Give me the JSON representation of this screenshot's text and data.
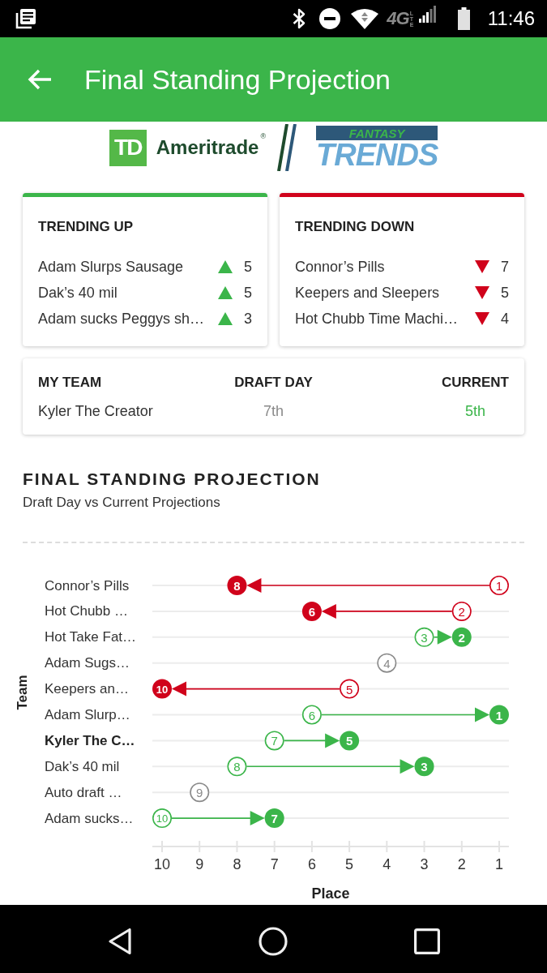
{
  "status_bar": {
    "network": "4G",
    "network_detail": "LTE",
    "time": "11:46"
  },
  "app_bar": {
    "title": "Final Standing Projection"
  },
  "sponsor_logos": {
    "td_mark": "TD",
    "brand": "Ameritrade",
    "registered": "®",
    "product_top": "FANTASY",
    "product": "TRENDS"
  },
  "trend_cards": [
    {
      "kind": "up",
      "title": "TRENDING UP",
      "items": [
        {
          "team": "Adam Slurps Sausage",
          "change": "5"
        },
        {
          "team": "Dak’s 40 mil",
          "change": "5"
        },
        {
          "team": "Adam sucks Peggys sh…",
          "change": "3"
        }
      ]
    },
    {
      "kind": "down",
      "title": "TRENDING DOWN",
      "items": [
        {
          "team": "Connor’s Pills",
          "change": "7"
        },
        {
          "team": "Keepers and Sleepers",
          "change": "5"
        },
        {
          "team": "Hot Chubb Time Machi…",
          "change": "4"
        }
      ]
    }
  ],
  "my_team": {
    "columns": [
      "MY TEAM",
      "DRAFT DAY",
      "CURRENT"
    ],
    "team": "Kyler The Creator",
    "draft_day": "7th",
    "current": "5th"
  },
  "chart": {
    "title": "FINAL STANDING PROJECTION",
    "subtitle": "Draft Day vs Current Projections",
    "bold_rows": [
      false,
      false,
      false,
      false,
      false,
      false,
      true,
      false,
      false,
      false
    ],
    "chart_data": {
      "type": "scatter",
      "orientation": "horizontal",
      "xlabel": "Place",
      "ylabel": "Team",
      "categories": [
        "Connor’s Pills",
        "Hot Chubb …",
        "Hot Take Fat…",
        "Adam Sugs…",
        "Keepers an…",
        "Adam Slurp…",
        "Kyler The C…",
        "Dak’s 40 mil",
        "Auto draft …",
        "Adam sucks…"
      ],
      "series": [
        {
          "colors": [
            "#d0021b",
            "#d0021b",
            "#3bb54a",
            "#8a8a8a",
            "#d0021b",
            "#3bb54a",
            "#3bb54a",
            "#3bb54a",
            "#8a8a8a",
            "#3bb54a"
          ],
          "values": [
            1,
            2,
            3,
            4,
            5,
            6,
            7,
            8,
            9,
            10
          ]
        },
        {
          "colors": [
            "#d0021b",
            "#d0021b",
            "#3bb54a",
            null,
            "#d0021b",
            "#3bb54a",
            "#3bb54a",
            "#3bb54a",
            null,
            "#3bb54a"
          ],
          "values": [
            8,
            6,
            2,
            null,
            10,
            1,
            5,
            3,
            null,
            7
          ]
        }
      ],
      "xlim": [
        10.26,
        0.74
      ],
      "xticks": [
        {
          "value": 10,
          "label": "10"
        },
        {
          "value": 9,
          "label": "9"
        },
        {
          "value": 8,
          "label": "8"
        },
        {
          "value": 7,
          "label": "7"
        },
        {
          "value": 6,
          "label": "6"
        },
        {
          "value": 5,
          "label": "5"
        },
        {
          "value": 4,
          "label": "4"
        },
        {
          "value": 3,
          "label": "3"
        },
        {
          "value": 2,
          "label": "2"
        },
        {
          "value": 1,
          "label": "1"
        }
      ],
      "data_labels": true
    }
  }
}
